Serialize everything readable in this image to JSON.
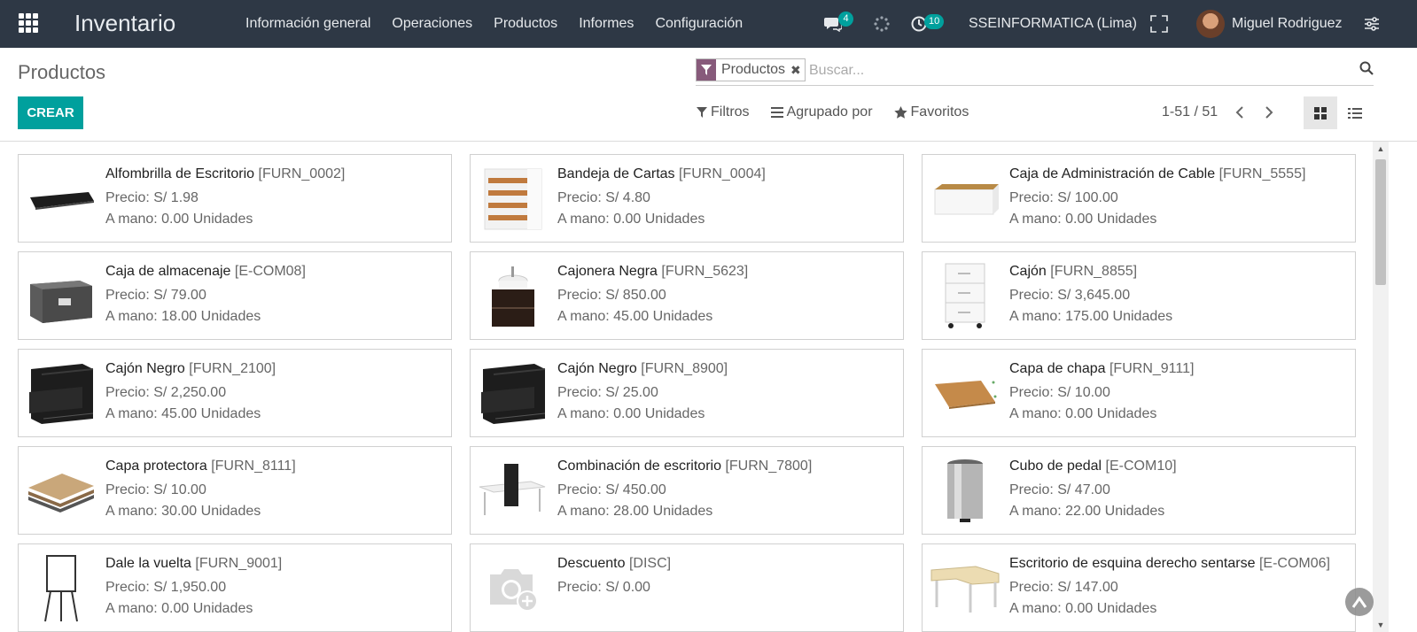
{
  "app": {
    "title": "Inventario"
  },
  "menu": [
    "Información general",
    "Operaciones",
    "Productos",
    "Informes",
    "Configuración"
  ],
  "systray": {
    "messages_badge": "4",
    "activities_badge": "10",
    "company": "SSEINFORMATICA (Lima)",
    "user": "Miguel Rodriguez"
  },
  "page": {
    "title": "Productos"
  },
  "search": {
    "facet": "Productos",
    "placeholder": "Buscar..."
  },
  "actions": {
    "create": "CREAR"
  },
  "filters": {
    "filters": "Filtros",
    "groupby": "Agrupado por",
    "favorites": "Favoritos"
  },
  "pager": {
    "value": "1-51 / 51"
  },
  "colors": {
    "navbar": "#2e3845",
    "primary": "#00a09d",
    "facet": "#875a7b"
  },
  "products": [
    {
      "name": "Alfombrilla de Escritorio",
      "code": "[FURN_0002]",
      "price": "Precio: S/ 1.98",
      "onhand": "A mano: 0.00 Unidades",
      "image": "desk-pad"
    },
    {
      "name": "Bandeja de Cartas",
      "code": "[FURN_0004]",
      "price": "Precio: S/ 4.80",
      "onhand": "A mano: 0.00 Unidades",
      "image": "letter-tray"
    },
    {
      "name": "Caja de Administración de Cable",
      "code": "[FURN_5555]",
      "price": "Precio: S/ 100.00",
      "onhand": "A mano: 0.00 Unidades",
      "image": "cable-box"
    },
    {
      "name": "Caja de almacenaje",
      "code": "[E-COM08]",
      "price": "Precio: S/ 79.00",
      "onhand": "A mano: 18.00 Unidades",
      "image": "storage-box"
    },
    {
      "name": "Cajonera Negra",
      "code": "[FURN_5623]",
      "price": "Precio: S/ 850.00",
      "onhand": "A mano: 45.00 Unidades",
      "image": "vanity"
    },
    {
      "name": "Cajón",
      "code": "[FURN_8855]",
      "price": "Precio: S/ 3,645.00",
      "onhand": "A mano: 175.00 Unidades",
      "image": "white-drawer"
    },
    {
      "name": "Cajón Negro",
      "code": "[FURN_2100]",
      "price": "Precio: S/ 2,250.00",
      "onhand": "A mano: 45.00 Unidades",
      "image": "black-drawer"
    },
    {
      "name": "Cajón Negro",
      "code": "[FURN_8900]",
      "price": "Precio: S/ 25.00",
      "onhand": "A mano: 0.00 Unidades",
      "image": "black-drawer"
    },
    {
      "name": "Capa de chapa",
      "code": "[FURN_9111]",
      "price": "Precio: S/ 10.00",
      "onhand": "A mano: 0.00 Unidades",
      "image": "wood-top"
    },
    {
      "name": "Capa protectora",
      "code": "[FURN_8111]",
      "price": "Precio: S/ 10.00",
      "onhand": "A mano: 30.00 Unidades",
      "image": "wood-layers"
    },
    {
      "name": "Combinación de escritorio",
      "code": "[FURN_7800]",
      "price": "Precio: S/ 450.00",
      "onhand": "A mano: 28.00 Unidades",
      "image": "desk-combo"
    },
    {
      "name": "Cubo de pedal",
      "code": "[E-COM10]",
      "price": "Precio: S/ 47.00",
      "onhand": "A mano: 22.00 Unidades",
      "image": "pedal-bin"
    },
    {
      "name": "Dale la vuelta",
      "code": "[FURN_9001]",
      "price": "Precio: S/ 1,950.00",
      "onhand": "A mano: 0.00 Unidades",
      "image": "flipchart"
    },
    {
      "name": "Descuento",
      "code": "[DISC]",
      "price": "Precio: S/ 0.00",
      "onhand": "",
      "image": "camera-placeholder"
    },
    {
      "name": "Escritorio de esquina derecho sentarse",
      "code": "[E-COM06]",
      "price": "Precio: S/ 147.00",
      "onhand": "A mano: 0.00 Unidades",
      "image": "corner-desk"
    }
  ]
}
